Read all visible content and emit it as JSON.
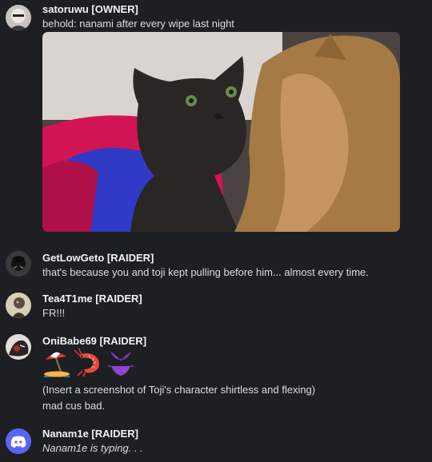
{
  "messages": [
    {
      "author": "satoruwu [OWNER]",
      "lines": [
        "behold: nanami after every wipe last night"
      ],
      "attachment": "cat photo"
    },
    {
      "author": "GetLowGeto [RAIDER]",
      "lines": [
        "that's because you and toji kept pulling before him... almost every time."
      ]
    },
    {
      "author": "Tea4T1me [RAIDER]",
      "lines": [
        "FR!!!"
      ]
    },
    {
      "author": "OniBabe69 [RAIDER]",
      "emojis": [
        "beach-umbrella-icon",
        "shrimp-icon",
        "bikini-icon"
      ],
      "lines": [
        "(Insert a screenshot of Toji's character shirtless and flexing)",
        "mad cus bad."
      ]
    },
    {
      "author": "Nanam1e [RAIDER]",
      "lines": [
        "Nanam1e is typing. . ."
      ],
      "avatar_icon": "discord-logo-icon"
    }
  ],
  "colors": {
    "background": "#1e1f22",
    "author": "#f2f3f5",
    "text": "#dbdee1",
    "discord_blurple": "#5865f2"
  }
}
